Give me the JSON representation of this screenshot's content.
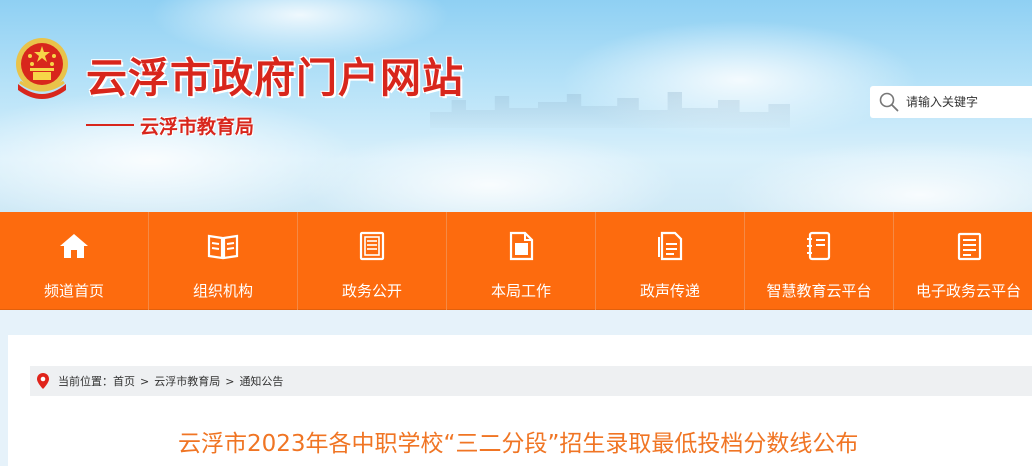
{
  "header": {
    "site_title": "云浮市政府门户网站",
    "sub_title": "云浮市教育局",
    "emblem_icon": "national-emblem-icon"
  },
  "search": {
    "placeholder": "请输入关键字",
    "icon": "search-icon"
  },
  "nav": {
    "items": [
      {
        "label": "频道首页",
        "icon": "home-icon"
      },
      {
        "label": "组织机构",
        "icon": "open-book-icon"
      },
      {
        "label": "政务公开",
        "icon": "document-list-icon"
      },
      {
        "label": "本局工作",
        "icon": "file-icon"
      },
      {
        "label": "政声传递",
        "icon": "document-copy-icon"
      },
      {
        "label": "智慧教育云平台",
        "icon": "notebook-icon"
      },
      {
        "label": "电子政务云平台",
        "icon": "notes-icon"
      }
    ]
  },
  "breadcrumb": {
    "prefix": "当前位置：",
    "items": [
      "首页",
      "云浮市教育局",
      "通知公告"
    ],
    "separator": ">",
    "icon": "location-pin-icon"
  },
  "article": {
    "title": "云浮市2023年各中职学校“三二分段”招生录取最低投档分数线公布"
  },
  "colors": {
    "nav_bg": "#fd6b0e",
    "title_red": "#d8261c",
    "article_title": "#f07524"
  }
}
